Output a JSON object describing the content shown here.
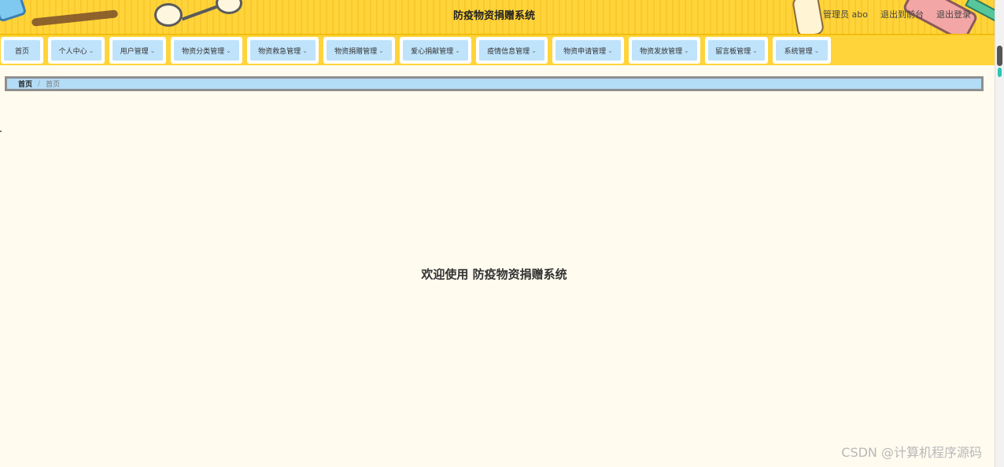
{
  "header": {
    "title": "防疫物资捐赠系统",
    "user": "管理员 abo",
    "links": [
      "退出到前台",
      "退出登录"
    ]
  },
  "nav": {
    "items": [
      {
        "label": "首页",
        "dropdown": false
      },
      {
        "label": "个人中心",
        "dropdown": true
      },
      {
        "label": "用户管理",
        "dropdown": true
      },
      {
        "label": "物资分类管理",
        "dropdown": true
      },
      {
        "label": "物资救急管理",
        "dropdown": true
      },
      {
        "label": "物资捐赠管理",
        "dropdown": true
      },
      {
        "label": "爱心捐献管理",
        "dropdown": true
      },
      {
        "label": "疫情信息管理",
        "dropdown": true
      },
      {
        "label": "物资申请管理",
        "dropdown": true
      },
      {
        "label": "物资发放管理",
        "dropdown": true
      },
      {
        "label": "留言板管理",
        "dropdown": true
      },
      {
        "label": "系统管理",
        "dropdown": true
      }
    ]
  },
  "breadcrumb": {
    "home": "首页",
    "separator": "/",
    "current": "首页"
  },
  "main": {
    "welcome": "欢迎使用 防疫物资捐赠系统"
  },
  "watermark": "CSDN @计算机程序源码",
  "colors": {
    "header_bg": "#ffd43a",
    "nav_inner": "#bfe3fb",
    "breadcrumb_bg": "#b3dcf7",
    "page_bg": "#fffbef"
  }
}
